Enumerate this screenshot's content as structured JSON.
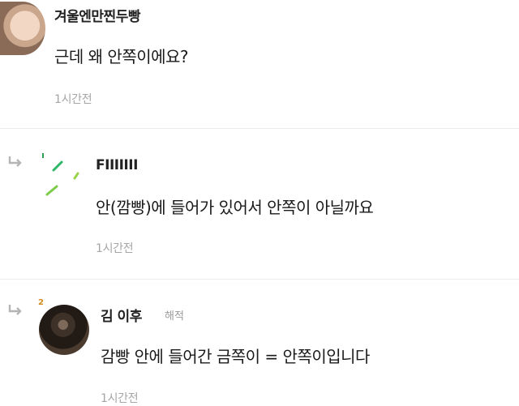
{
  "comments": [
    {
      "author": "겨울엔만찐두빵",
      "text": "근데 왜 안쪽이에요?",
      "time": "1시간전"
    },
    {
      "author": "FIIIIIII",
      "text": "안(깜빵)에 들어가 있어서 안쪽이 아닐까요",
      "time": "1시간전",
      "is_reply": true
    },
    {
      "author": "김 이후",
      "badge": "해적",
      "text": "감빵 안에 들어간 금쪽이 = 안쪽이입니다",
      "time": "1시간전",
      "is_reply": true
    }
  ],
  "icons": {
    "reply": "reply-arrow-icon"
  }
}
